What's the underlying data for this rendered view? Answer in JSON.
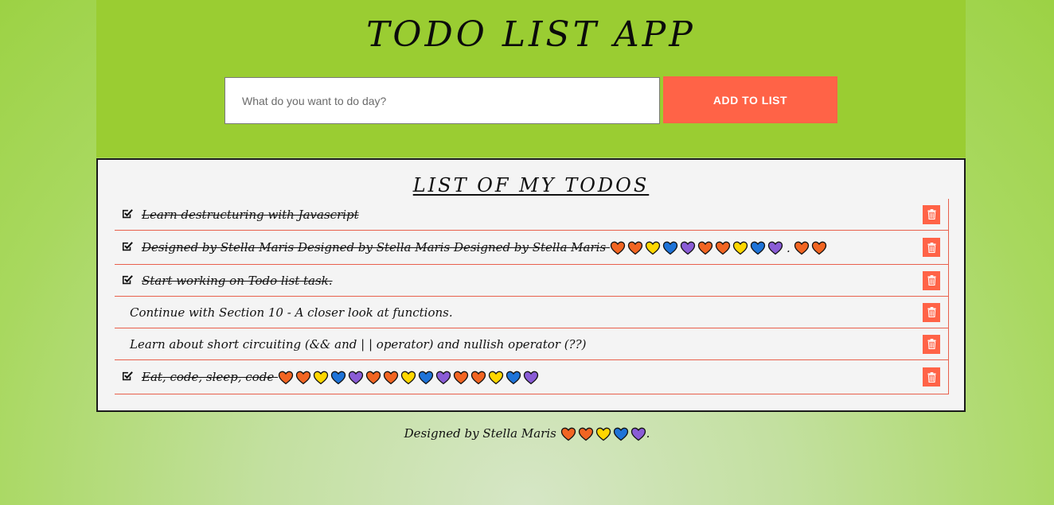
{
  "header": {
    "title": "TODO LIST APP",
    "input_placeholder": "What do you want to do day?",
    "input_value": "",
    "add_button_label": "ADD TO LIST"
  },
  "list": {
    "title": "LIST OF MY TODOS",
    "items": [
      {
        "text": "Learn destructuring with Javascript",
        "done": true,
        "hearts": []
      },
      {
        "text": "Designed by Stella Maris Designed by Stella Maris Designed by Stella Maris",
        "done": true,
        "hearts": [
          "orange",
          "orange",
          "yellow",
          "blue",
          "purple",
          "orange",
          "orange",
          "yellow",
          "blue",
          "purple",
          "orange",
          "orange"
        ],
        "separator": "."
      },
      {
        "text": "Start working on Todo list task.",
        "done": true,
        "hearts": []
      },
      {
        "text": "Continue with Section 10 - A closer look at functions.",
        "done": false,
        "hearts": []
      },
      {
        "text": "Learn about short circuiting (&& and | | operator) and nullish operator (??)",
        "done": false,
        "hearts": []
      },
      {
        "text": "Eat, code, sleep, code",
        "done": true,
        "hearts": [
          "orange",
          "orange",
          "yellow",
          "blue",
          "purple",
          "orange",
          "orange",
          "yellow",
          "blue",
          "purple",
          "orange",
          "orange",
          "yellow",
          "blue",
          "purple"
        ]
      }
    ]
  },
  "footer": {
    "text": "Designed by Stella Maris",
    "hearts": [
      "orange",
      "orange",
      "yellow",
      "blue",
      "purple"
    ],
    "suffix": "."
  },
  "colors": {
    "header_bg": "#9acd32",
    "accent": "#ff6347",
    "panel_bg": "#f4f4f4",
    "heart_orange": "#f26522",
    "heart_yellow": "#ffd700",
    "heart_blue": "#1e73d8",
    "heart_purple": "#8a5cd6"
  },
  "icons": {
    "check": "check-square-icon",
    "delete": "trash-icon",
    "heart": "heart-icon"
  }
}
